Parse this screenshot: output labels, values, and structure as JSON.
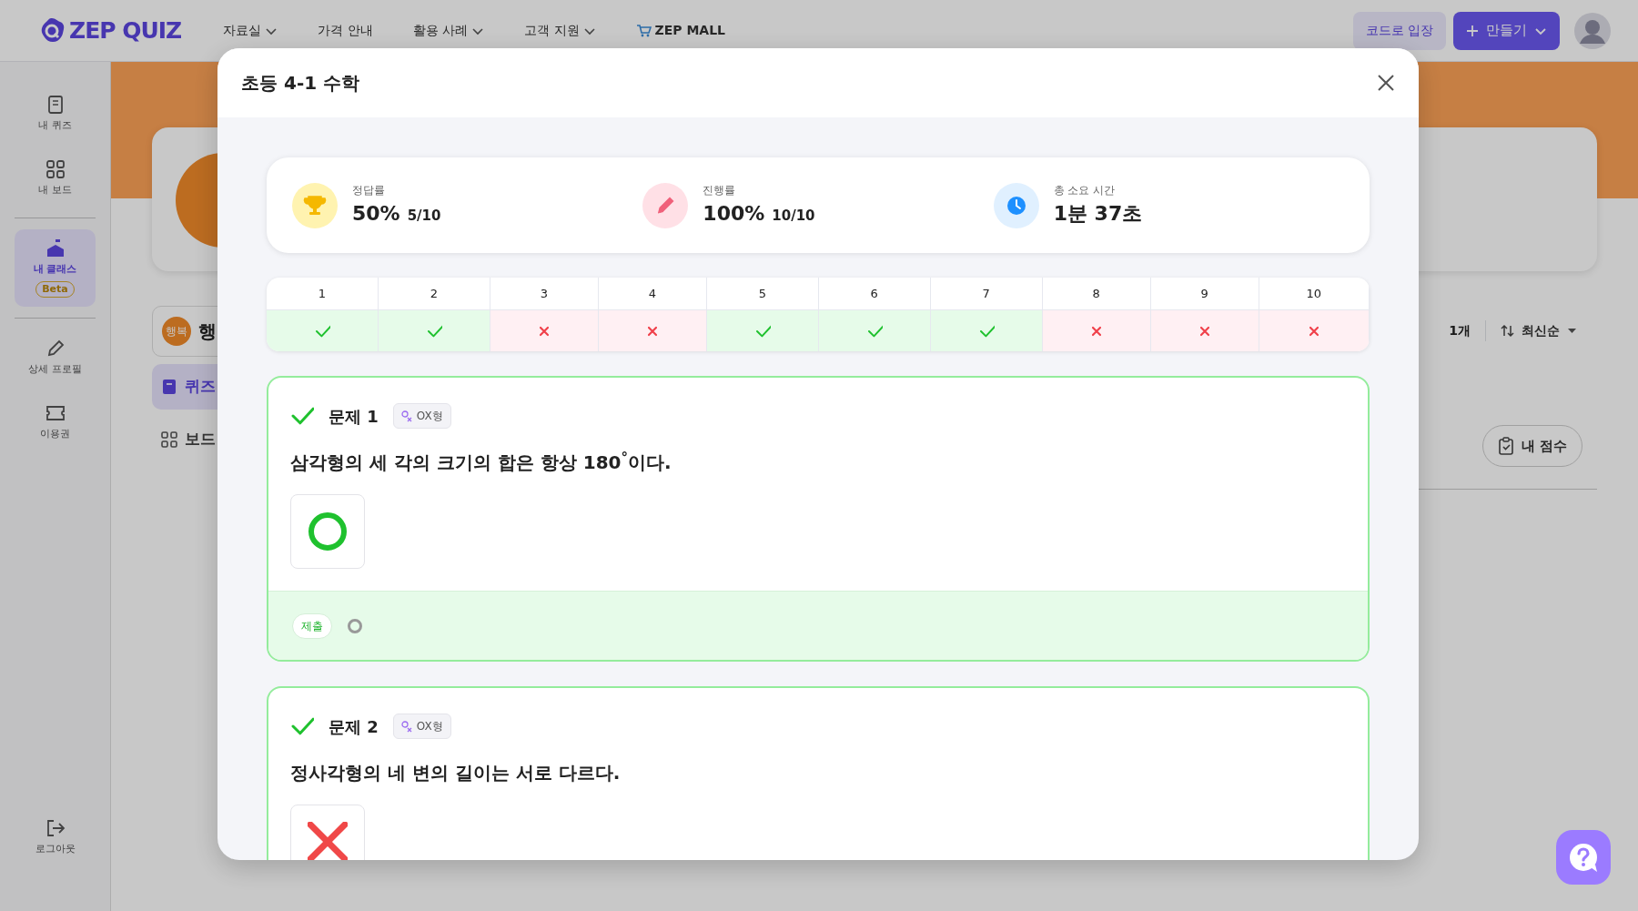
{
  "nav": {
    "logo": "ZEP QUIZ",
    "menu": [
      {
        "label": "자료실",
        "dropdown": true
      },
      {
        "label": "가격 안내",
        "dropdown": false
      },
      {
        "label": "활용 사례",
        "dropdown": true
      },
      {
        "label": "고객 지원",
        "dropdown": true
      }
    ],
    "mall": "ZEP MALL",
    "code_button": "코드로 입장",
    "create_button": "만들기"
  },
  "sidebar": {
    "items": [
      {
        "label": "내 퀴즈",
        "selected": false
      },
      {
        "label": "내 보드",
        "selected": false
      },
      {
        "label": "내 클래스",
        "selected": true,
        "badge": "Beta"
      },
      {
        "label": "상세 프로필",
        "selected": false
      },
      {
        "label": "이용권",
        "selected": false
      }
    ],
    "logout": "로그아웃"
  },
  "background": {
    "class_chip": "행복",
    "class_name": "행",
    "tabs": [
      {
        "label": "퀴즈",
        "selected": true
      },
      {
        "label": "보드",
        "selected": false
      }
    ],
    "count": "1개",
    "sort": "최신순",
    "my_score": "내 점수"
  },
  "modal": {
    "title": "초등 4-1 수학",
    "stats": [
      {
        "kind": "accuracy",
        "label": "정답률",
        "value": "50%",
        "sub": "5/10"
      },
      {
        "kind": "progress",
        "label": "진행률",
        "value": "100%",
        "sub": "10/10"
      },
      {
        "kind": "time",
        "label": "총 소요 시간",
        "value": "1분 37초"
      }
    ],
    "results": [
      {
        "number": "1",
        "correct": true
      },
      {
        "number": "2",
        "correct": true
      },
      {
        "number": "3",
        "correct": false
      },
      {
        "number": "4",
        "correct": false
      },
      {
        "number": "5",
        "correct": true
      },
      {
        "number": "6",
        "correct": true
      },
      {
        "number": "7",
        "correct": true
      },
      {
        "number": "8",
        "correct": false
      },
      {
        "number": "9",
        "correct": false
      },
      {
        "number": "10",
        "correct": false
      }
    ],
    "questions": [
      {
        "title": "문제 1",
        "correct": true,
        "type": "OX형",
        "text": "삼각형의 세 각의 크기의 합은 항상 180$^{°}$이다.",
        "answer": {
          "kind": "circle"
        },
        "submitted": {
          "label": "제출",
          "kind": "circle"
        }
      },
      {
        "title": "문제 2",
        "correct": true,
        "type": "OX형",
        "text": "정사각형의 네 변의 길이는 서로 다르다.",
        "answer": {
          "kind": "cross"
        }
      }
    ]
  }
}
